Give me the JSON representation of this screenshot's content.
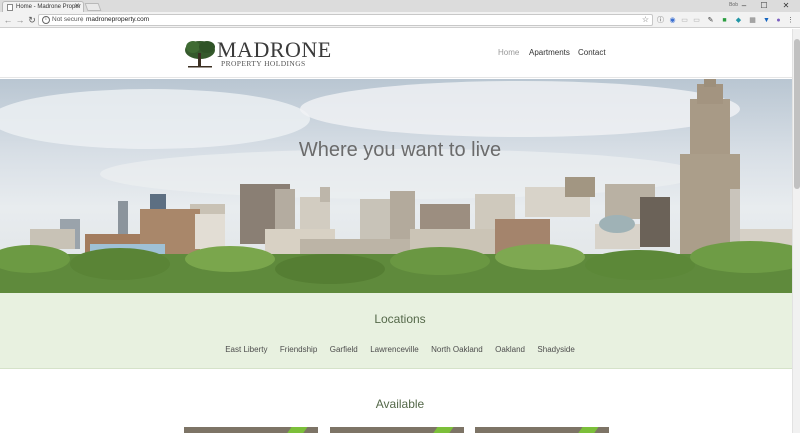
{
  "browser": {
    "tab_title": "Home - Madrone Proper",
    "profile_label": "Bob",
    "omnibox": {
      "security_label": "Not secure",
      "url": "madroneproperty.com"
    }
  },
  "site": {
    "logo_title": "MADRONE",
    "logo_subtitle": "PROPERTY HOLDINGS",
    "nav": [
      {
        "label": "Home",
        "active": true
      },
      {
        "label": "Apartments",
        "active": false
      },
      {
        "label": "Contact",
        "active": false
      }
    ]
  },
  "hero": {
    "headline": "Where you want to live"
  },
  "locations": {
    "title": "Locations",
    "items": [
      "East Liberty",
      "Friendship",
      "Garfield",
      "Lawrenceville",
      "North Oakland",
      "Oakland",
      "Shadyside"
    ]
  },
  "available": {
    "title": "Available"
  },
  "colors": {
    "accent_green": "#55694a",
    "locations_bg": "#e8f1e0",
    "card_stripe": "#7cbf3a"
  }
}
